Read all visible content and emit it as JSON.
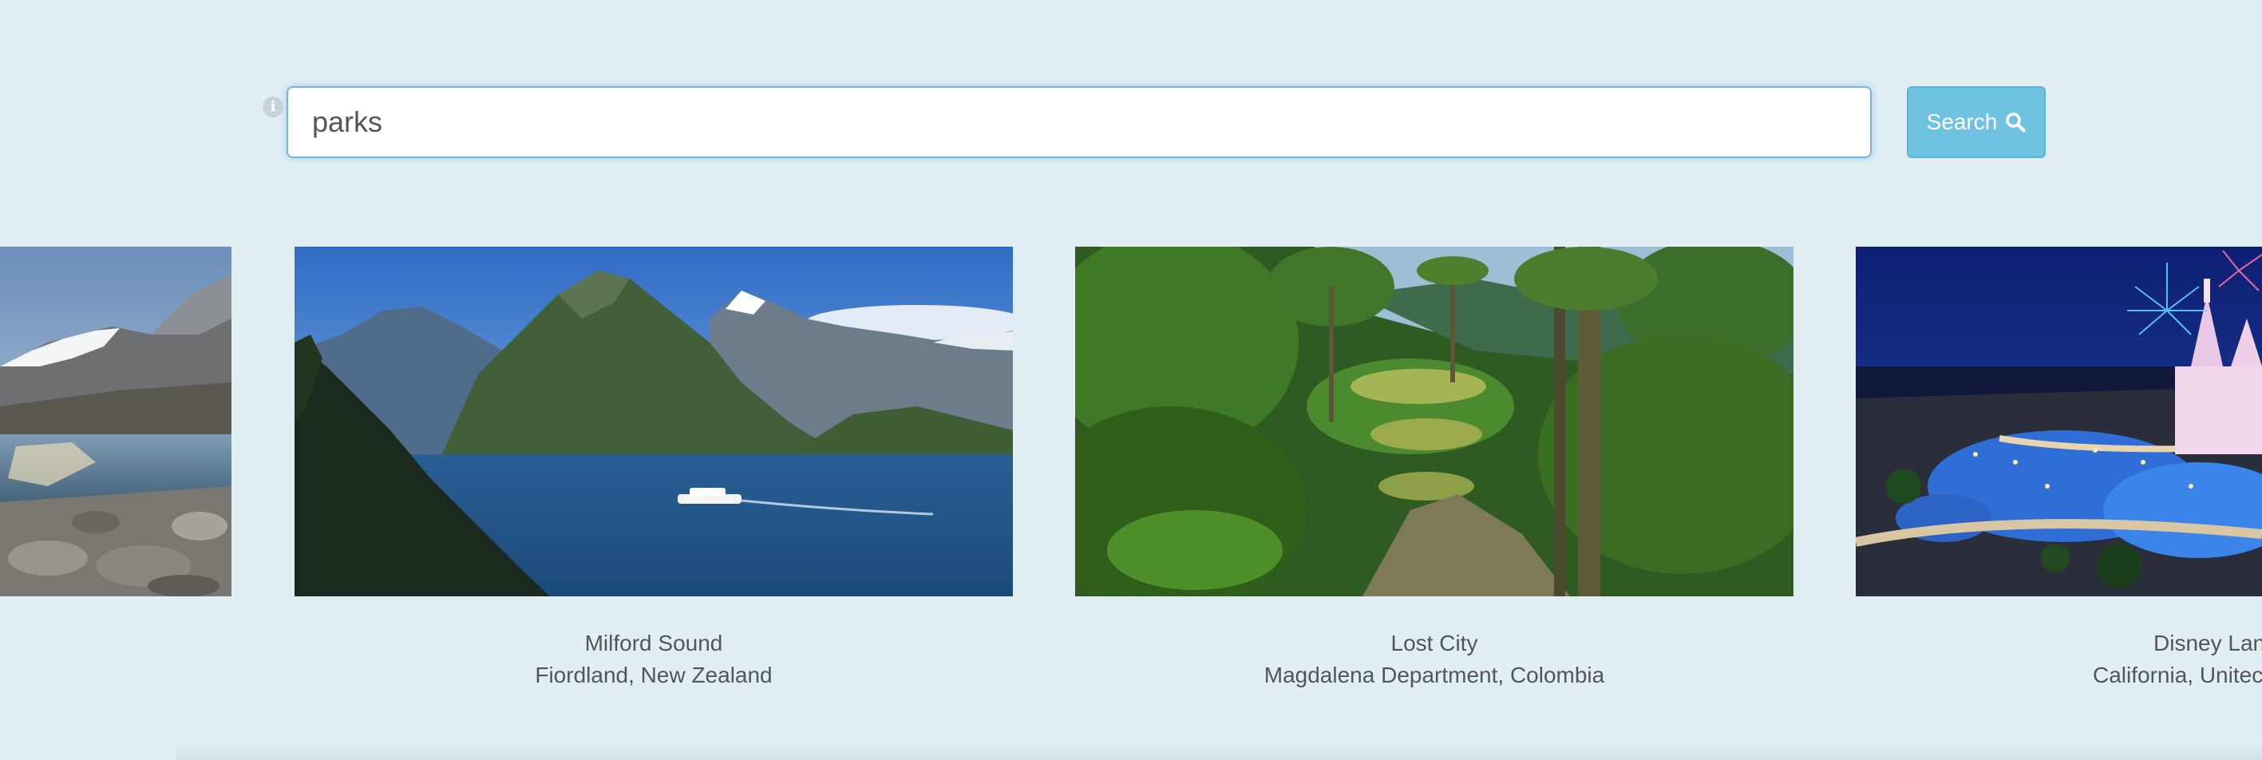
{
  "search": {
    "value": "parks",
    "button_label": "Search",
    "info_glyph": "i",
    "info_icon": "info-icon",
    "search_icon": "magnifier-icon"
  },
  "cards": [
    {
      "title": "",
      "location": "",
      "scene": "glacier lake with snowy mountains"
    },
    {
      "title": "Milford Sound",
      "location": "Fiordland, New Zealand",
      "scene": "fjord with cruise ship"
    },
    {
      "title": "Lost City",
      "location": "Magdalena Department, Colombia",
      "scene": "jungle terraces"
    },
    {
      "title": "Disney Lan",
      "location": "California, Unitec",
      "scene": "castle with fireworks at night"
    }
  ],
  "colors": {
    "background": "#e1eff5",
    "button": "#70c2e2",
    "input_border": "#7fb2d9",
    "caption_text": "#555555"
  }
}
